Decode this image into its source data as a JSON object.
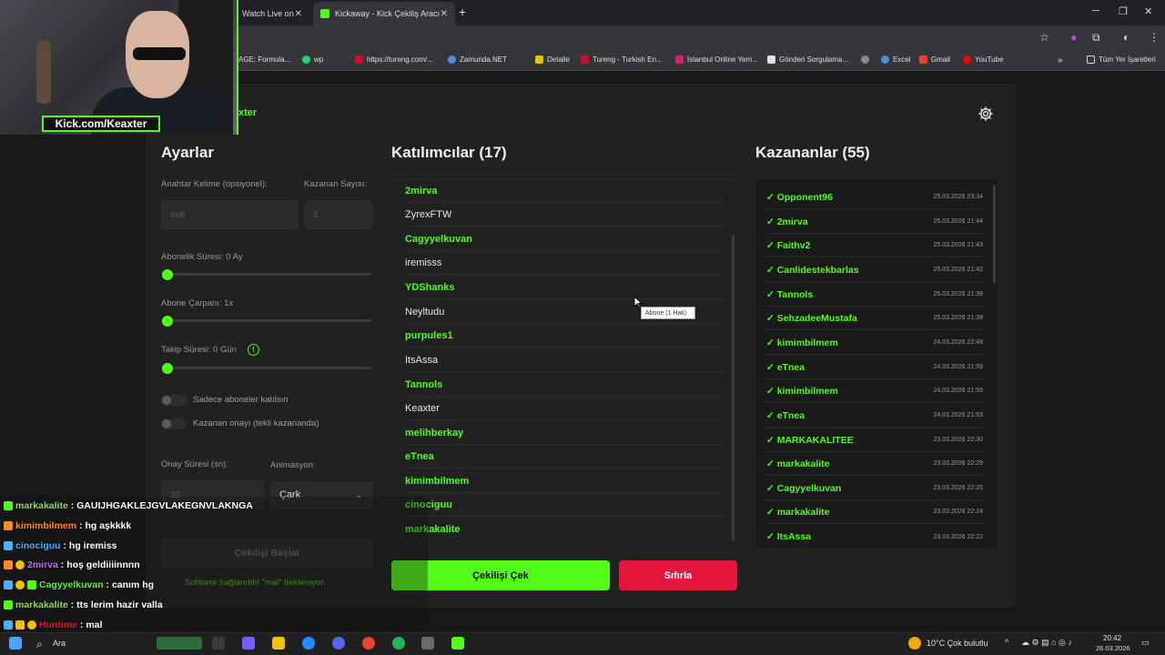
{
  "browser": {
    "tabs": [
      {
        "title": "Watch Live on"
      },
      {
        "title": "Kickaway - Kick Çekiliş Aracı"
      }
    ],
    "bookmarks": [
      "AGE: Formula...",
      "wp",
      "https://tureng.com/...",
      "Zamunda.NET",
      "Detalle",
      "Tureng - Turkish En...",
      "İstanbul Online Yem...",
      "Gönderi Sorgulama...",
      "Excel",
      "Gmail",
      "YouTube",
      "Tüm Yer İşaretleri"
    ]
  },
  "webcam": {
    "label": "Kick.com/Keaxter"
  },
  "brand_fragment": "xter",
  "settings": {
    "title": "Ayarlar",
    "keyword_label": "Anahtar Kelime (opsiyonel):",
    "keyword_placeholder": "mal",
    "winner_count_label": "Kazanan Sayısı:",
    "winner_count_placeholder": "1",
    "sub_duration_label": "Abonelik Süresi: 0 Ay",
    "sub_multiplier_label": "Abone Çarpanı: 1x",
    "follow_duration_label": "Takip Süresi:  0  Gün",
    "only_subs_label": "Sadece aboneler katılsın",
    "winner_approval_label": "Kazanan onayı (tekli kazananda)",
    "approval_time_label": "Onay Süresi (sn):",
    "approval_time_placeholder": "30",
    "animation_label": "Animasyon:",
    "animation_value": "Çark",
    "start_button": "Çekilişi Başlat",
    "status": "Sohbete bağlanıldı! \"mal\" bekleniyor."
  },
  "participants": {
    "title": "Katılımcılar (17)",
    "items": [
      {
        "name": "2mirva",
        "sub": true
      },
      {
        "name": "ZyrexFTW",
        "sub": false
      },
      {
        "name": "Cagyyelkuvan",
        "sub": true
      },
      {
        "name": "iremisss",
        "sub": false
      },
      {
        "name": "YDShanks",
        "sub": true
      },
      {
        "name": "Neyltudu",
        "sub": false
      },
      {
        "name": "purpules1",
        "sub": true
      },
      {
        "name": "ItsAssa",
        "sub": false
      },
      {
        "name": "Tannols",
        "sub": true
      },
      {
        "name": "Keaxter",
        "sub": false
      },
      {
        "name": "melihberkay",
        "sub": true
      },
      {
        "name": "eTnea",
        "sub": true
      },
      {
        "name": "kimimbilmem",
        "sub": true
      },
      {
        "name": "cinociguu",
        "sub": true
      },
      {
        "name": "markakalite",
        "sub": true
      }
    ],
    "tooltip": "Abone (1 Hak)",
    "draw_button": "Çekilişi Çek",
    "reset_button": "Sıfırla"
  },
  "winners": {
    "title": "Kazananlar (55)",
    "items": [
      {
        "name": "✓ Opponent96",
        "date": "25.03.2026 23:34"
      },
      {
        "name": "✓ 2mirva",
        "date": "25.03.2026 21:44"
      },
      {
        "name": "✓ Faithv2",
        "date": "25.03.2026 21:43"
      },
      {
        "name": "✓ Canlidestekbarlas",
        "date": "25.03.2026 21:42"
      },
      {
        "name": "✓ Tannols",
        "date": "25.03.2026 21:39"
      },
      {
        "name": "✓ SehzadeeMustafa",
        "date": "25.03.2026 21:39"
      },
      {
        "name": "✓ kimimbilmem",
        "date": "24.03.2026 22:49"
      },
      {
        "name": "✓ eTnea",
        "date": "24.03.2026 21:59"
      },
      {
        "name": "✓ kimimbilmem",
        "date": "24.03.2026 21:55"
      },
      {
        "name": "✓ eTnea",
        "date": "24.03.2026 21:53"
      },
      {
        "name": "✓ MARKAKALITEE",
        "date": "23.03.2026 22:30"
      },
      {
        "name": "✓ markakalite",
        "date": "23.03.2026 22:29"
      },
      {
        "name": "✓ Cagyyelkuvan",
        "date": "23.03.2026 22:25"
      },
      {
        "name": "✓ markakalite",
        "date": "23.03.2026 22:24"
      },
      {
        "name": "✓ ItsAssa",
        "date": "23.03.2026 22:22"
      }
    ]
  },
  "chat": [
    {
      "user": "markakalite",
      "text": ": GAUIJHGAKLEJGVLAKEGNVLAKNGA",
      "color": "#9ad56a"
    },
    {
      "user": "kimimbilmem",
      "text": ": hg aşkkkk",
      "color": "#ff8a2b"
    },
    {
      "user": "cinociguu",
      "text": ": hg iremiss",
      "color": "#4bb0ff"
    },
    {
      "user": "2mirva",
      "text": ": hoş geldiiiinnnn",
      "color": "#c06bff"
    },
    {
      "user": "Cagyyelkuvan",
      "text": ": canım hg",
      "color": "#53fc18"
    },
    {
      "user": "markakalite",
      "text": ": tts lerim hazir valla",
      "color": "#9ad56a"
    },
    {
      "user": "Huntime",
      "text": ": mal",
      "color": "#e5153e"
    }
  ],
  "taskbar": {
    "search": "Ara",
    "weather": "10°C  Çok bulutlu",
    "time": "20:42",
    "date": "26.03.2026"
  },
  "colors": {
    "accent": "#53fc18",
    "danger": "#e5153e"
  }
}
